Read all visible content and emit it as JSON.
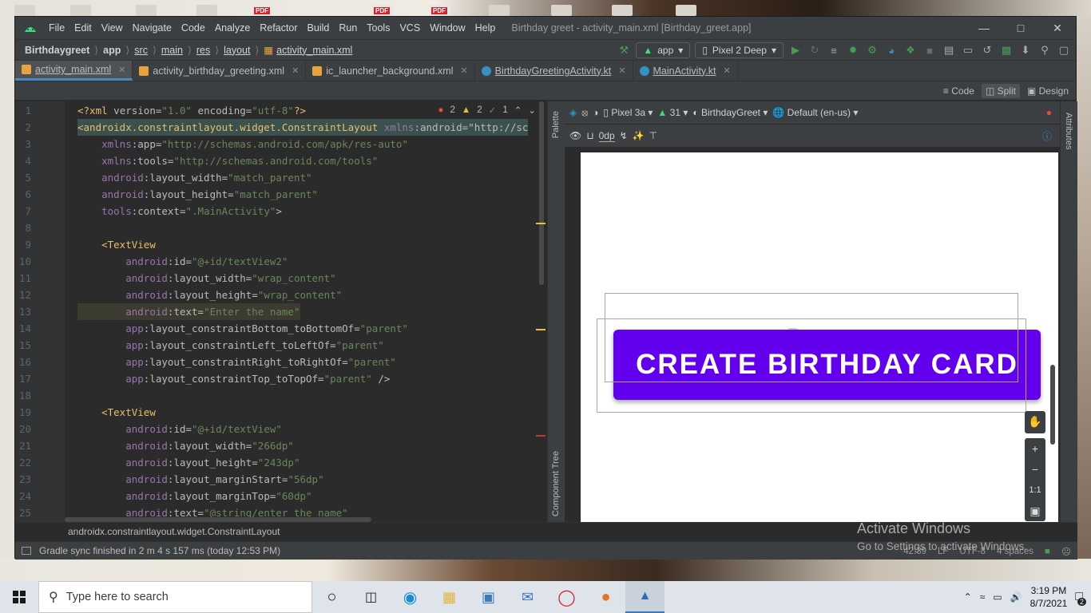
{
  "window": {
    "title": "Birthday greet - activity_main.xml [Birthday_greet.app]",
    "menu": [
      "File",
      "Edit",
      "View",
      "Navigate",
      "Code",
      "Analyze",
      "Refactor",
      "Build",
      "Run",
      "Tools",
      "VCS",
      "Window",
      "Help"
    ]
  },
  "navbar": {
    "breadcrumb": [
      "Birthdaygreet",
      "app",
      "src",
      "main",
      "res",
      "layout",
      "activity_main.xml"
    ],
    "run_config": "app",
    "device": "Pixel 2 Deep"
  },
  "tabs": [
    {
      "label": "activity_main.xml",
      "color": "#e8a33d"
    },
    {
      "label": "activity_birthday_greeting.xml",
      "color": "#e8a33d"
    },
    {
      "label": "ic_launcher_background.xml",
      "color": "#e8a33d"
    },
    {
      "label": "BirthdayGreetingActivity.kt",
      "color": "#3592c4"
    },
    {
      "label": "MainActivity.kt",
      "color": "#3592c4"
    }
  ],
  "modes": {
    "code": "Code",
    "split": "Split",
    "design": "Design"
  },
  "problems": {
    "errors": "2",
    "warnings": "2",
    "ok": "1"
  },
  "code_lines": [
    {
      "n": "1",
      "text": "<?xml version=\"1.0\" encoding=\"utf-8\"?>"
    },
    {
      "n": "2",
      "text": "<androidx.constraintlayout.widget.ConstraintLayout xmlns:android=\"http://sc"
    },
    {
      "n": "3",
      "text": "    xmlns:app=\"http://schemas.android.com/apk/res-auto\""
    },
    {
      "n": "4",
      "text": "    xmlns:tools=\"http://schemas.android.com/tools\""
    },
    {
      "n": "5",
      "text": "    android:layout_width=\"match_parent\""
    },
    {
      "n": "6",
      "text": "    android:layout_height=\"match_parent\""
    },
    {
      "n": "7",
      "text": "    tools:context=\".MainActivity\">"
    },
    {
      "n": "8",
      "text": ""
    },
    {
      "n": "9",
      "text": "    <TextView"
    },
    {
      "n": "10",
      "text": "        android:id=\"@+id/textView2\""
    },
    {
      "n": "11",
      "text": "        android:layout_width=\"wrap_content\""
    },
    {
      "n": "12",
      "text": "        android:layout_height=\"wrap_content\""
    },
    {
      "n": "13",
      "text": "        android:text=\"Enter the name\""
    },
    {
      "n": "14",
      "text": "        app:layout_constraintBottom_toBottomOf=\"parent\""
    },
    {
      "n": "15",
      "text": "        app:layout_constraintLeft_toLeftOf=\"parent\""
    },
    {
      "n": "16",
      "text": "        app:layout_constraintRight_toRightOf=\"parent\""
    },
    {
      "n": "17",
      "text": "        app:layout_constraintTop_toTopOf=\"parent\" />"
    },
    {
      "n": "18",
      "text": ""
    },
    {
      "n": "19",
      "text": "    <TextView"
    },
    {
      "n": "20",
      "text": "        android:id=\"@+id/textView\""
    },
    {
      "n": "21",
      "text": "        android:layout_width=\"266dp\""
    },
    {
      "n": "22",
      "text": "        android:layout_height=\"243dp\""
    },
    {
      "n": "23",
      "text": "        android:layout_marginStart=\"56dp\""
    },
    {
      "n": "24",
      "text": "        android:layout_marginTop=\"60dp\""
    },
    {
      "n": "25",
      "text": "        android:text=\"@string/enter_the_name\""
    }
  ],
  "design": {
    "device": "Pixel 3a",
    "api": "31",
    "theme": "BirthdayGreet",
    "locale": "Default (en-us)",
    "margin": "0dp",
    "button_text": "CREATE BIRTHDAY CARD",
    "ghost_text": "D",
    "zoom_fit": "1:1",
    "palette_label": "Palette",
    "tree_label": "Component Tree",
    "attributes_label": "Attributes"
  },
  "bottom_breadcrumb": "androidx.constraintlayout.widget.ConstraintLayout",
  "status": {
    "message": "Gradle sync finished in 2 m 4 s 157 ms (today 12:53 PM)",
    "position": "42:39",
    "line_sep": "LF",
    "encoding": "UTF-8",
    "indent": "4 spaces"
  },
  "watermark": {
    "line1": "Activate Windows",
    "line2": "Go to Settings to activate Windows."
  },
  "taskbar": {
    "search_placeholder": "Type here to search",
    "time": "3:19 PM",
    "date": "8/7/2021",
    "notifications": "2"
  }
}
